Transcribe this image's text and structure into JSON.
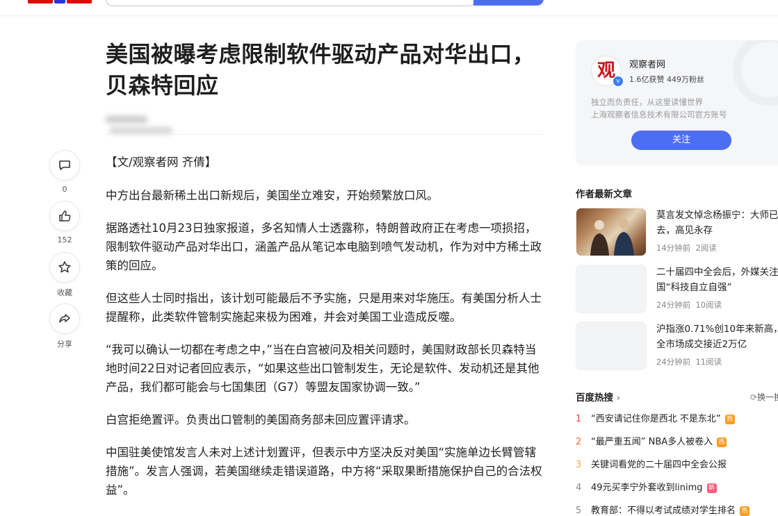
{
  "header": {
    "logo": "Bai百度"
  },
  "article": {
    "title_line1": "美国被曝考虑限制软件驱动产品对华出口，",
    "title_line2": "贝森特回应",
    "paragraphs": [
      "【文/观察者网 齐倩】",
      "中方出台最新稀土出口新规后，美国坐立难安，开始频繁放口风。",
      "据路透社10月23日独家报道，多名知情人士透露称，特朗普政府正在考虑一项损招，限制软件驱动产品对华出口，涵盖产品从笔记本电脑到喷气发动机，作为对中方稀土政策的回应。",
      "但这些人士同时指出，该计划可能最后不予实施，只是用来对华施压。有美国分析人士提醒称，此类软件管制实施起来极为困难，并会对美国工业造成反噬。",
      "“我可以确认一切都在考虑之中，”当在白宫被问及相关问题时，美国财政部长贝森特当地时间22日对记者回应表示，“如果这些出口管制发生，无论是软件、发动机还是其他产品，我们都可能会与七国集团（G7）等盟友国家协调一致。”",
      "白宫拒绝置评。负责出口管制的美国商务部未回应置评请求。",
      "中国驻美使馆发言人未对上述计划置评，但表示中方坚决反对美国“实施单边长臂管辖措施”。发言人强调，若美国继续走错误道路，中方将“采取果断措施保护自己的合法权益”。"
    ]
  },
  "actions": {
    "comment_count": "0",
    "like_count": "152",
    "favorite_label": "收藏",
    "share_label": "分享"
  },
  "author": {
    "avatar_char": "观",
    "name": "观察者网",
    "stats": "1.6亿获赞 449万粉丝",
    "desc1": "独立而负责任，从这里读懂世界",
    "desc2": "上海观察者信息技术有限公司官方账号",
    "follow_label": "关注"
  },
  "latest": {
    "title": "作者最新文章",
    "items": [
      {
        "title": "莫言发文悼念杨振宁：大师已去，高见永存",
        "time": "14分钟前",
        "reads": "2阅读"
      },
      {
        "title": "二十届四中全会后，外媒关注中国“科技自立自强”",
        "time": "24分钟前",
        "reads": "10阅读"
      },
      {
        "title": "沪指涨0.71%创10年来新高，全市场成交接近2万亿",
        "time": "24分钟前",
        "reads": "11阅读"
      }
    ]
  },
  "hot": {
    "title": "百度热搜",
    "refresh_label": "换一换",
    "items": [
      {
        "rank": "1",
        "text": "“西安请记住你是西北 不是东北”",
        "badge": "热",
        "badge_color": "#ff9a1f",
        "rank_color": "#f5443c"
      },
      {
        "rank": "2",
        "text": "“最严重五闻” NBA多人被卷入",
        "badge": "热",
        "badge_color": "#ff9a1f",
        "rank_color": "#ff6a2b"
      },
      {
        "rank": "3",
        "text": "关键词看党的二十届四中全会公报",
        "badge": "",
        "badge_color": "",
        "rank_color": "#f2a93b"
      },
      {
        "rank": "4",
        "text": "49元买李宁外套收到linimg",
        "badge": "新",
        "badge_color": "#ff5a7a",
        "rank_color": "#888888"
      },
      {
        "rank": "5",
        "text": "教育部：不得以考试成绩对学生排名",
        "badge": "热",
        "badge_color": "#ff9a1f",
        "rank_color": "#888888"
      }
    ]
  }
}
